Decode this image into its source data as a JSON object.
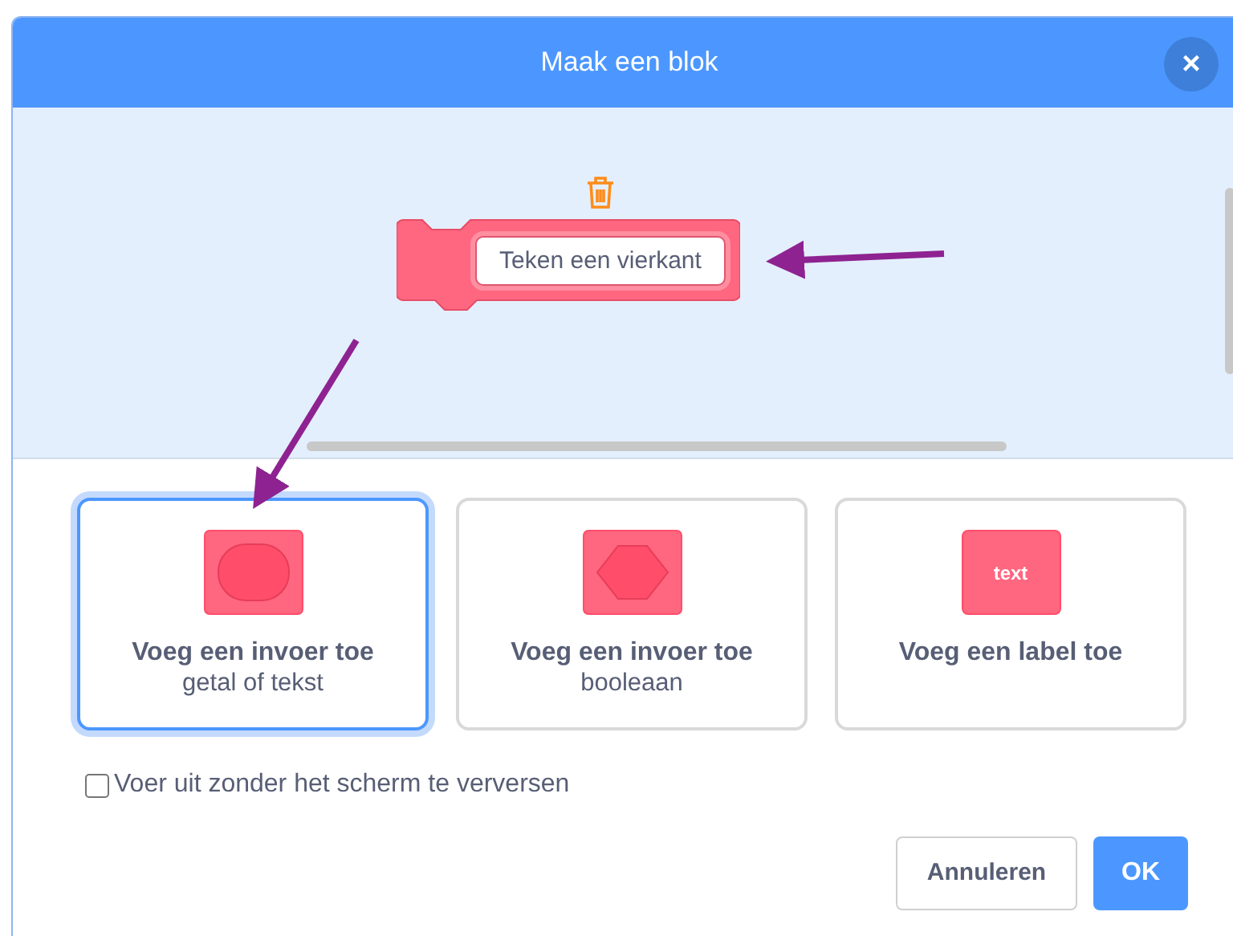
{
  "dialog": {
    "title": "Maak een blok",
    "close_label": "×"
  },
  "preview": {
    "block_text": "Teken een vierkant"
  },
  "options": [
    {
      "kind": "number_text",
      "title": "Voeg een invoer toe",
      "subtitle": "getal of tekst",
      "selected": true
    },
    {
      "kind": "boolean",
      "title": "Voeg een invoer toe",
      "subtitle": "booleaan",
      "selected": false
    },
    {
      "kind": "label",
      "title": "Voeg een label toe",
      "icon_text": "text",
      "selected": false
    }
  ],
  "run_without_refresh": {
    "label": "Voer uit zonder het scherm te verversen",
    "checked": false
  },
  "buttons": [
    {
      "kind": "cancel",
      "label": "Annuleren"
    },
    {
      "kind": "ok",
      "label": "OK"
    }
  ]
}
